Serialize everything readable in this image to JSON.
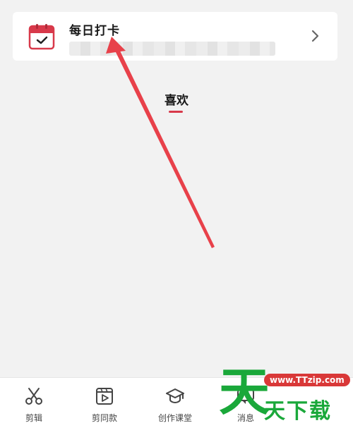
{
  "card": {
    "title": "每日打卡",
    "icon": "calendar-check-icon",
    "chevron": "chevron-right-icon"
  },
  "section": {
    "label": "喜欢",
    "accent": "#d8394a"
  },
  "arrow": {
    "color": "#e8414a"
  },
  "bottom_nav": {
    "items": [
      {
        "label": "剪辑",
        "icon": "scissors-icon"
      },
      {
        "label": "剪同款",
        "icon": "template-play-icon"
      },
      {
        "label": "创作课堂",
        "icon": "graduation-cap-icon"
      },
      {
        "label": "消息",
        "icon": "message-icon"
      }
    ]
  },
  "watermark": {
    "big": "天",
    "url": "www.TTzip.com",
    "text": "天下载"
  }
}
